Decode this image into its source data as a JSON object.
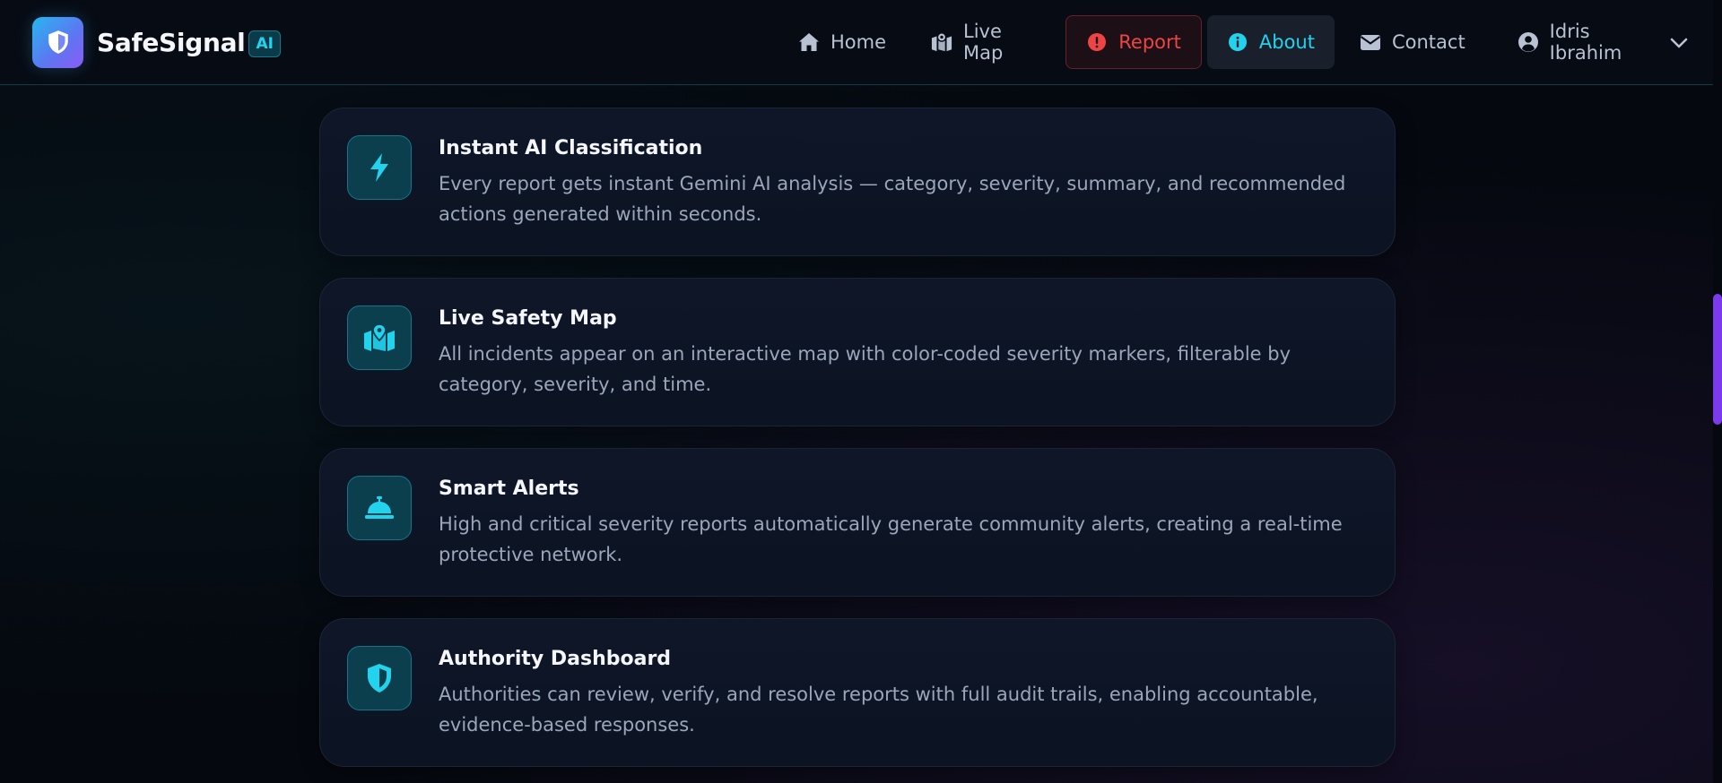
{
  "brand": {
    "name": "SafeSignal",
    "badge": "AI"
  },
  "nav": {
    "home": "Home",
    "live_map": "Live Map",
    "report": "Report",
    "about": "About",
    "contact": "Contact",
    "user": "Idris Ibrahim"
  },
  "features": [
    {
      "icon": "bolt-icon",
      "title": "Instant AI Classification",
      "description": "Every report gets instant Gemini AI analysis — category, severity, summary, and recommended actions generated within seconds."
    },
    {
      "icon": "map-location-icon",
      "title": "Live Safety Map",
      "description": "All incidents appear on an interactive map with color-coded severity markers, filterable by category, severity, and time."
    },
    {
      "icon": "bell-concierge-icon",
      "title": "Smart Alerts",
      "description": "High and critical severity reports automatically generate community alerts, creating a real-time protective network."
    },
    {
      "icon": "shield-icon",
      "title": "Authority Dashboard",
      "description": "Authorities can review, verify, and resolve reports with full audit trails, enabling accountable, evidence-based responses."
    }
  ],
  "colors": {
    "accent": "#22d3ee",
    "report": "#ef4444",
    "scrollbar": "#7c3aed",
    "background": "#05080f"
  }
}
